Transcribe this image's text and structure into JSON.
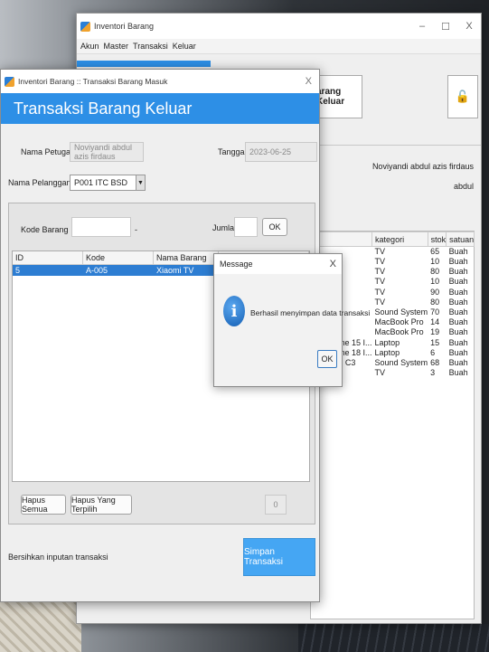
{
  "main_window": {
    "title": "Inventori Barang",
    "controls": [
      "–",
      "☐",
      "X"
    ],
    "menu": [
      "Akun",
      "Master",
      "Transaksi",
      "Keluar"
    ],
    "btn_keluar": "arang Keluar",
    "lock_icon": "🔓",
    "user_full": "Noviyandi abdul azis firdaus",
    "user_short": "abdul",
    "table": {
      "headers": [
        "",
        "kategori",
        "stok",
        "satuan"
      ],
      "rows": [
        [
          "",
          "TV",
          "65",
          "Buah"
        ],
        [
          "",
          "TV",
          "10",
          "Buah"
        ],
        [
          "h",
          "TV",
          "80",
          "Buah"
        ],
        [
          "",
          "TV",
          "10",
          "Buah"
        ],
        [
          "ng",
          "TV",
          "90",
          "Buah"
        ],
        [
          "ch",
          "TV",
          "80",
          "Buah"
        ],
        [
          "",
          "Sound System",
          "70",
          "Buah"
        ],
        [
          "Inch",
          "MacBook Pro",
          "14",
          "Buah"
        ],
        [
          "Inch",
          "MacBook Pro",
          "19",
          "Buah"
        ],
        [
          "spire One 15 I...",
          "Laptop",
          "15",
          "Buah"
        ],
        [
          "spire One 18 I...",
          "Laptop",
          "6",
          "Buah"
        ],
        [
          "da Type C3",
          "Sound System",
          "68",
          "Buah"
        ],
        [
          "TV",
          "TV",
          "3",
          "Buah"
        ]
      ]
    }
  },
  "dialog": {
    "title": "Inventori Barang :: Transaksi Barang Masuk",
    "header": "Transaksi Barang Keluar",
    "nama_petugas_label": "Nama Petugas",
    "nama_petugas_value": "Noviyandi abdul azis firdaus",
    "tanggal_label": "Tanggal",
    "tanggal_value": "2023-06-25",
    "nama_pelanggan_label": "Nama Pelanggan",
    "pelanggan_value": "P001 ITC BSD",
    "kode_barang_label": "Kode Barang",
    "dash": "-",
    "jumlah_label": "Jumlah",
    "ok": "OK",
    "grid_headers": [
      "ID",
      "Kode",
      "Nama Barang",
      ""
    ],
    "grid_row": [
      "5",
      "A-005",
      "Xiaomi TV",
      ""
    ],
    "hapus_semua": "Hapus Semua",
    "hapus_terpilih": "Hapus Yang Terpilih",
    "total_value": "0",
    "bersihkan": "Bersihkan inputan transaksi",
    "simpan": "Simpan Transaksi"
  },
  "message": {
    "title": "Message",
    "close": "X",
    "text": "Berhasil menyimpan data transaksi",
    "ok": "OK",
    "icon": "i"
  }
}
